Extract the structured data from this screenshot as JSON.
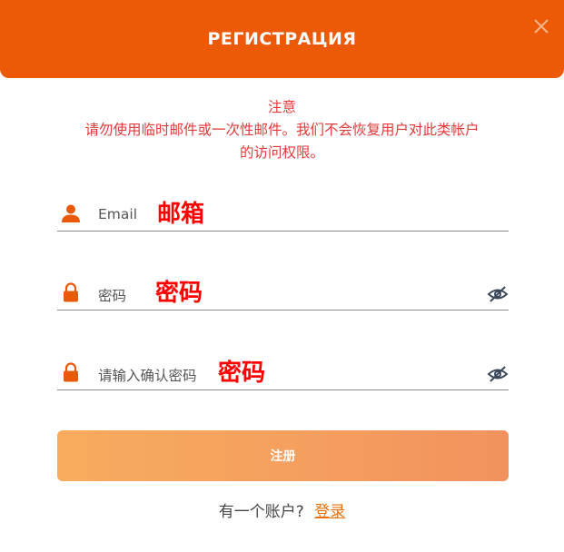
{
  "header": {
    "title": "РЕГИСТРАЦИЯ"
  },
  "notice": {
    "title": "注意",
    "line1": "请勿使用临时邮件或一次性邮件。我们不会恢复用户对此类帐户",
    "line2": "的访问权限。"
  },
  "form": {
    "email": {
      "label": "Email",
      "value": "邮箱",
      "icon": "user-icon"
    },
    "password": {
      "label": "密码",
      "value": "密码",
      "icon": "lock-icon"
    },
    "confirm": {
      "label": "请输入确认密码",
      "value": "密码",
      "icon": "lock-icon"
    }
  },
  "submit": {
    "label": "注册"
  },
  "footer": {
    "text": "有一个账户?",
    "link": "登录"
  },
  "colors": {
    "brand": "#ec5a08",
    "notice": "#e23a3a",
    "link": "#e8700c",
    "overlay_text": "#ff0000"
  }
}
